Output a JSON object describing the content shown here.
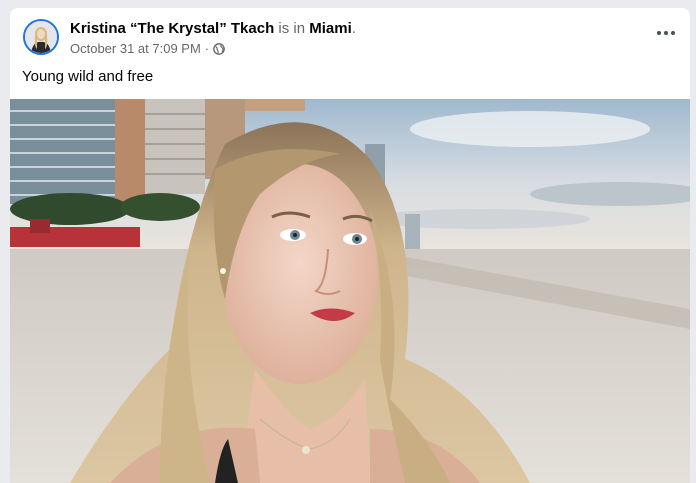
{
  "post": {
    "author": "Kristina “The Krystal” Tkach",
    "verb": "is in",
    "location": "Miami",
    "location_suffix": ".",
    "timestamp": "October 31 at 7:09 PM",
    "separator": "·",
    "privacy_icon": "globe-icon",
    "more_icon": "more-options-icon",
    "text": "Young wild and free"
  },
  "colors": {
    "accent": "#1b74e4",
    "text_primary": "#050505",
    "text_secondary": "#65676b",
    "card_bg": "#ffffff",
    "page_bg": "#e9ebee"
  }
}
